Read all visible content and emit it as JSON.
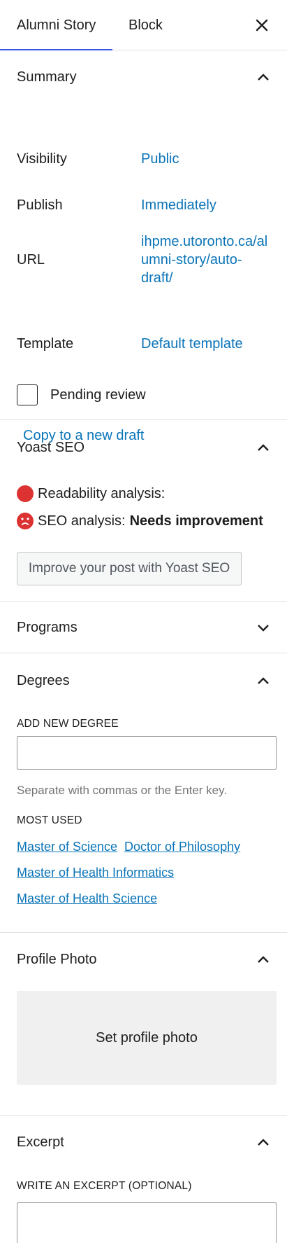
{
  "tabs": {
    "active": "Alumni Story",
    "second": "Block"
  },
  "summary": {
    "title": "Summary",
    "visibility_label": "Visibility",
    "visibility_value": "Public",
    "publish_label": "Publish",
    "publish_value": "Immediately",
    "url_label": "URL",
    "url_line1": "ihpme.utoronto.ca/al",
    "url_line2": "umni-story/auto-",
    "url_line3": "draft/",
    "template_label": "Template",
    "template_value": "Default template",
    "pending_label": "Pending review",
    "copy_link": "Copy to a new draft"
  },
  "yoast": {
    "title": "Yoast SEO",
    "readability_label": "Readability analysis:",
    "seo_label": "SEO analysis:",
    "seo_status": "Needs improvement",
    "improve_button": "Improve your post with Yoast SEO",
    "status_color": "#dc3232"
  },
  "programs": {
    "title": "Programs"
  },
  "degrees": {
    "title": "Degrees",
    "add_label": "ADD NEW DEGREE",
    "input_value": "",
    "help_text": "Separate with commas or the Enter key.",
    "most_used_label": "MOST USED",
    "tags": [
      "Master of Science",
      "Doctor of Philosophy",
      "Master of Health Informatics",
      "Master of Health Science"
    ]
  },
  "profile_photo": {
    "title": "Profile Photo",
    "set_button": "Set profile photo"
  },
  "excerpt": {
    "title": "Excerpt",
    "write_label": "WRITE AN EXCERPT (OPTIONAL)"
  },
  "colors": {
    "accent": "#0a74b8",
    "tab_indicator": "#3858e9"
  },
  "icons": {
    "close": "close-icon",
    "expanded": "chevron-up-icon",
    "collapsed": "chevron-down-icon"
  }
}
